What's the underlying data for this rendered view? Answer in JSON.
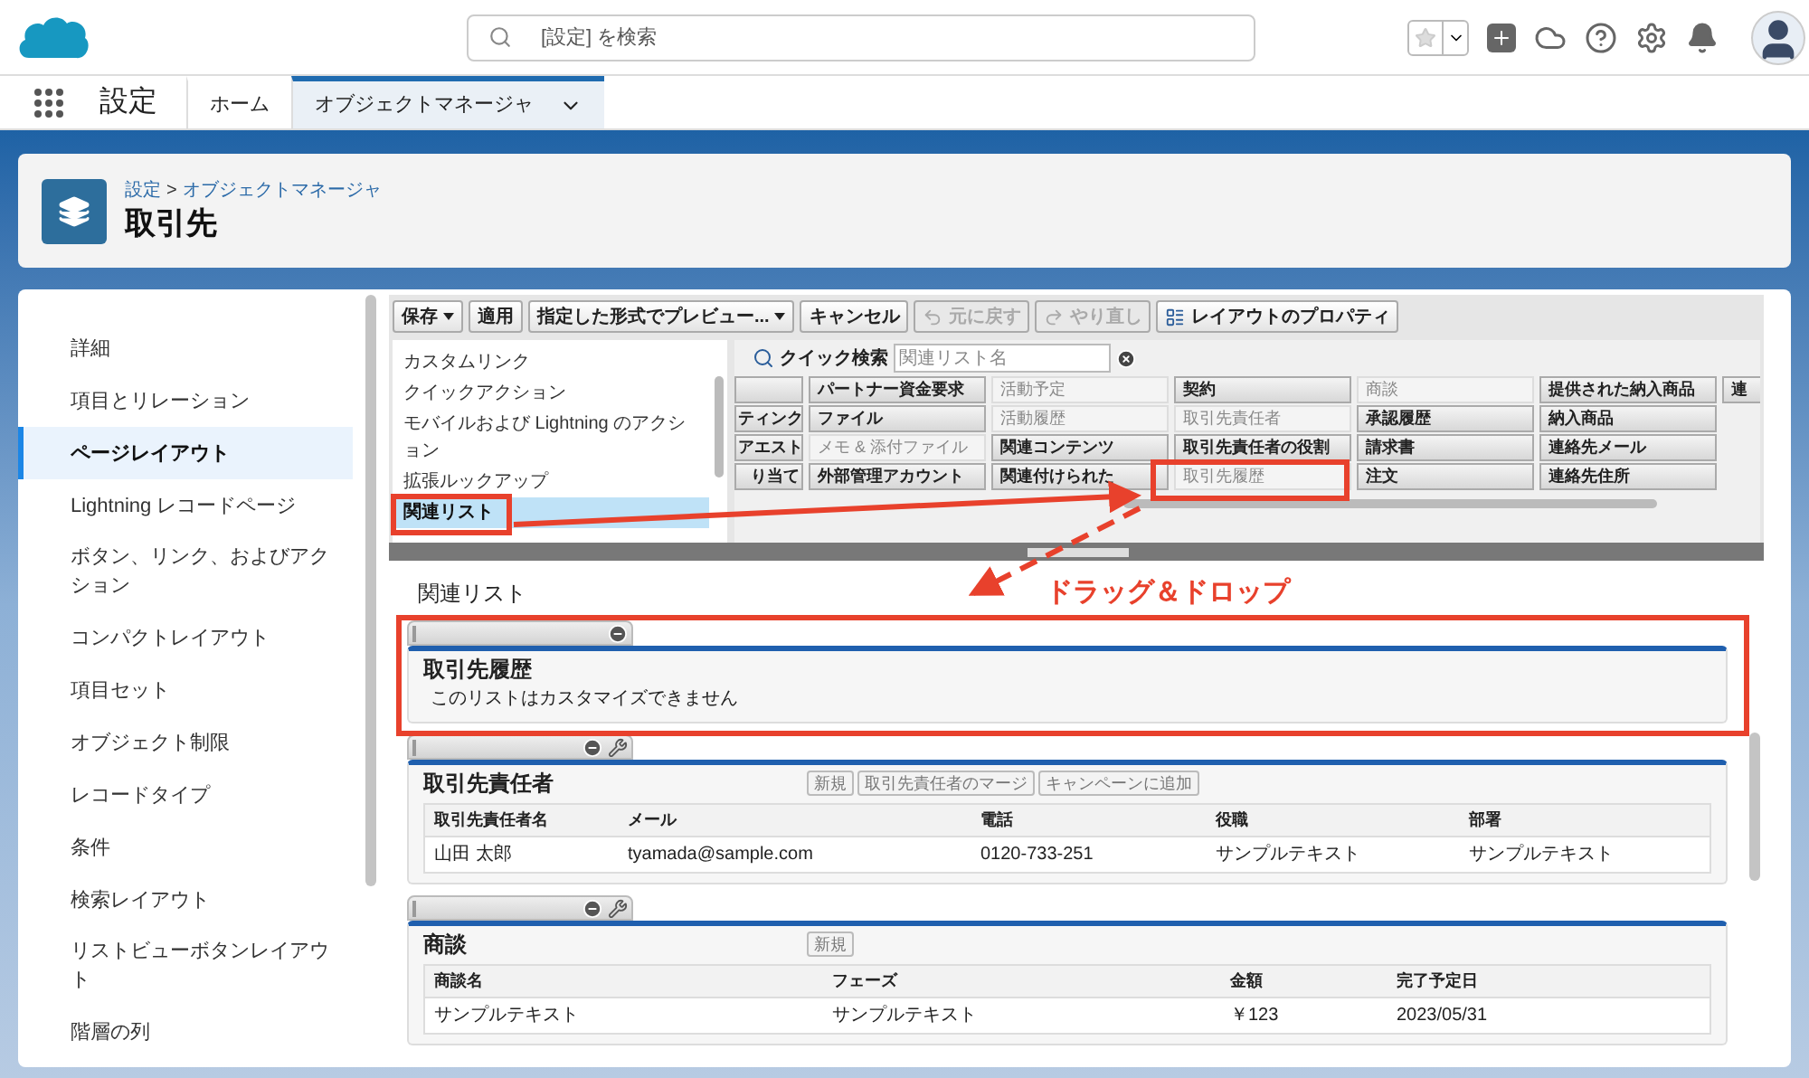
{
  "top_bar": {
    "search": {
      "placeholder": "[設定] を検索"
    }
  },
  "nav": {
    "app_name": "設定",
    "tabs": [
      {
        "label": "ホーム",
        "selected": false
      },
      {
        "label": "オブジェクトマネージャ",
        "selected": true
      }
    ]
  },
  "header": {
    "breadcrumb": [
      "設定",
      "オブジェクトマネージャ"
    ],
    "separator": ">",
    "title": "取引先"
  },
  "sidebar": {
    "items": [
      {
        "label": "詳細",
        "selected": false
      },
      {
        "label": "項目とリレーション",
        "selected": false
      },
      {
        "label": "ページレイアウト",
        "selected": true
      },
      {
        "label": "Lightning レコードページ",
        "selected": false
      },
      {
        "label": "ボタン、リンク、およびアクション",
        "selected": false
      },
      {
        "label": "コンパクトレイアウト",
        "selected": false
      },
      {
        "label": "項目セット",
        "selected": false
      },
      {
        "label": "オブジェクト制限",
        "selected": false
      },
      {
        "label": "レコードタイプ",
        "selected": false
      },
      {
        "label": "条件",
        "selected": false
      },
      {
        "label": "検索レイアウト",
        "selected": false
      },
      {
        "label": "リストビューボタンレイアウト",
        "selected": false
      },
      {
        "label": "階層の列",
        "selected": false
      }
    ]
  },
  "palette": {
    "toolbar": [
      {
        "label": "保存",
        "kind": "dropdown",
        "disabled": false
      },
      {
        "label": "適用",
        "kind": "plain",
        "disabled": false
      },
      {
        "label": "指定した形式でプレビュー...",
        "kind": "dropdown",
        "disabled": false
      },
      {
        "label": "キャンセル",
        "kind": "plain",
        "disabled": false
      },
      {
        "label": "元に戻す",
        "kind": "undo",
        "disabled": true
      },
      {
        "label": "やり直し",
        "kind": "redo",
        "disabled": true
      },
      {
        "label": "レイアウトのプロパティ",
        "kind": "properties",
        "disabled": false
      }
    ],
    "categories": [
      {
        "label": "カスタムリンク",
        "selected": false
      },
      {
        "label": "クイックアクション",
        "selected": false
      },
      {
        "label": "モバイルおよび Lightning のアクション",
        "selected": false
      },
      {
        "label": "拡張ルックアップ",
        "selected": false
      },
      {
        "label": "関連リスト",
        "selected": true
      }
    ],
    "quick_search": {
      "label": "クイック検索",
      "placeholder": "関連リスト名"
    },
    "grid": [
      [
        {
          "used": false
        },
        {
          "label": "パートナー資金要求",
          "used": false
        },
        {
          "label": "活動予定",
          "used": true
        },
        {
          "label": "契約",
          "used": false
        },
        {
          "label": "商談",
          "used": true
        },
        {
          "label": "提供された納入商品",
          "used": false
        },
        {
          "label": "連",
          "used": false
        }
      ],
      [
        {
          "label": "ティンク",
          "used": false
        },
        {
          "label": "ファイル",
          "used": false
        },
        {
          "label": "活動履歴",
          "used": true
        },
        {
          "label": "取引先責任者",
          "used": true
        },
        {
          "label": "承認履歴",
          "used": false
        },
        {
          "label": "納入商品",
          "used": false
        }
      ],
      [
        {
          "label": "アエスト",
          "used": false
        },
        {
          "label": "メモ & 添付ファイル",
          "used": true
        },
        {
          "label": "関連コンテンツ",
          "used": false
        },
        {
          "label": "取引先責任者の役割",
          "used": false
        },
        {
          "label": "請求書",
          "used": false
        },
        {
          "label": "連絡先メール",
          "used": false
        }
      ],
      [
        {
          "label": "り当て",
          "used": false
        },
        {
          "label": "外部管理アカウント",
          "used": false
        },
        {
          "label": "関連付けられた",
          "used": false
        },
        {
          "label": "取引先履歴",
          "used": true
        },
        {
          "label": "注文",
          "used": false
        },
        {
          "label": "連絡先住所",
          "used": false
        }
      ]
    ]
  },
  "annotation": {
    "label": "ドラッグ＆ドロップ"
  },
  "layout": {
    "title": "関連リスト",
    "sections": [
      {
        "title": "取引先履歴",
        "has_properties": false,
        "message": "このリストはカスタマイズできません"
      },
      {
        "title": "取引先責任者",
        "has_properties": true,
        "buttons": [
          "新規",
          "取引先責任者のマージ",
          "キャンペーンに追加"
        ],
        "columns": [
          "取引先責任者名",
          "メール",
          "電話",
          "役職",
          "部署"
        ],
        "rows": [
          [
            "山田 太郎",
            "tyamada@sample.com",
            "0120-733-251",
            "サンプルテキスト",
            "サンプルテキスト"
          ]
        ]
      },
      {
        "title": "商談",
        "has_properties": true,
        "buttons": [
          "新規"
        ],
        "columns": [
          "商談名",
          "フェーズ",
          "金額",
          "完了予定日"
        ],
        "rows": [
          [
            "サンプルテキスト",
            "サンプルテキスト",
            "￥123",
            "2023/05/31"
          ]
        ]
      }
    ]
  }
}
